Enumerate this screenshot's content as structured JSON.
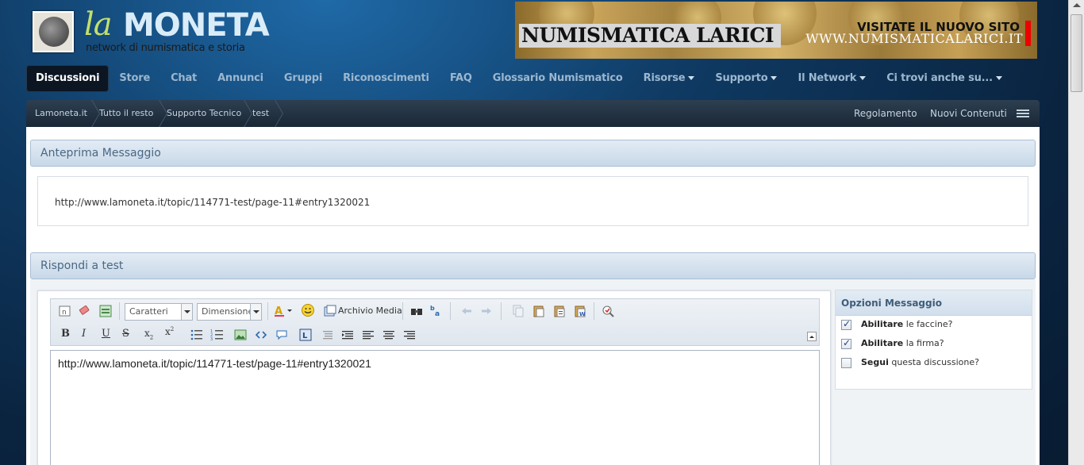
{
  "logo": {
    "la": "la",
    "moneta": "MONETA",
    "tagline": "network di numismatica e storia"
  },
  "banner": {
    "title": "NUMISMATICA LARICI",
    "cta": "VISITATE IL NUOVO SITO",
    "url": "WWW.NUMISMATICALARICI.IT"
  },
  "nav": {
    "items": [
      {
        "label": "Discussioni",
        "active": true,
        "dropdown": false
      },
      {
        "label": "Store",
        "active": false,
        "dropdown": false
      },
      {
        "label": "Chat",
        "active": false,
        "dropdown": false
      },
      {
        "label": "Annunci",
        "active": false,
        "dropdown": false
      },
      {
        "label": "Gruppi",
        "active": false,
        "dropdown": false
      },
      {
        "label": "Riconoscimenti",
        "active": false,
        "dropdown": false
      },
      {
        "label": "FAQ",
        "active": false,
        "dropdown": false
      },
      {
        "label": "Glossario Numismatico",
        "active": false,
        "dropdown": false
      },
      {
        "label": "Risorse",
        "active": false,
        "dropdown": true
      },
      {
        "label": "Supporto",
        "active": false,
        "dropdown": true
      },
      {
        "label": "Il Network",
        "active": false,
        "dropdown": true
      },
      {
        "label": "Ci trovi anche su...",
        "active": false,
        "dropdown": true
      }
    ]
  },
  "breadcrumb": {
    "items": [
      "Lamoneta.it",
      "Tutto il resto",
      "Supporto Tecnico",
      "test"
    ],
    "right_links": [
      "Regolamento",
      "Nuovi Contenuti"
    ]
  },
  "preview": {
    "heading": "Anteprima Messaggio",
    "text": "http://www.lamoneta.it/topic/114771-test/page-11#entry1320021"
  },
  "reply": {
    "heading": "Rispondi a test",
    "font_select": "Caratteri",
    "size_select": "Dimensione",
    "media_label": "Archivio Media",
    "editor_text": "http://www.lamoneta.it/topic/114771-test/page-11#entry1320021"
  },
  "options": {
    "heading": "Opzioni Messaggio",
    "items": [
      {
        "bold": "Abilitare",
        "rest": " le faccine?",
        "checked": true
      },
      {
        "bold": "Abilitare",
        "rest": " la firma?",
        "checked": true
      },
      {
        "bold": "Segui",
        "rest": " questa discussione?",
        "checked": false
      }
    ]
  },
  "colors": {
    "accent": "#4a6784",
    "nav_text": "#9cb7cf",
    "background": "#0f3a63"
  }
}
